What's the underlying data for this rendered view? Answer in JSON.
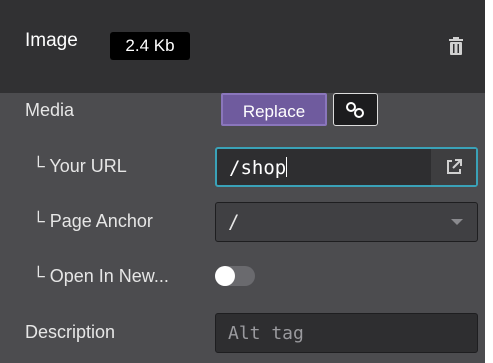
{
  "header": {
    "title": "Image",
    "size_badge": "2.4 Kb",
    "delete_icon": "trash-icon"
  },
  "media": {
    "label": "Media",
    "replace_label": "Replace",
    "link_icon": "link-icon"
  },
  "url": {
    "label": "└ Your URL",
    "value": "/shop",
    "open_icon": "external-link-icon"
  },
  "anchor": {
    "label": "└ Page Anchor",
    "value": "/"
  },
  "new_window": {
    "label": "└ Open In New...",
    "enabled": false
  },
  "description": {
    "label": "Description",
    "placeholder": "Alt tag",
    "value": ""
  },
  "colors": {
    "panel_bg": "#4c4c4f",
    "header_bg": "#313133",
    "accent": "#6f5b9e",
    "focus": "#3aa2b8"
  }
}
